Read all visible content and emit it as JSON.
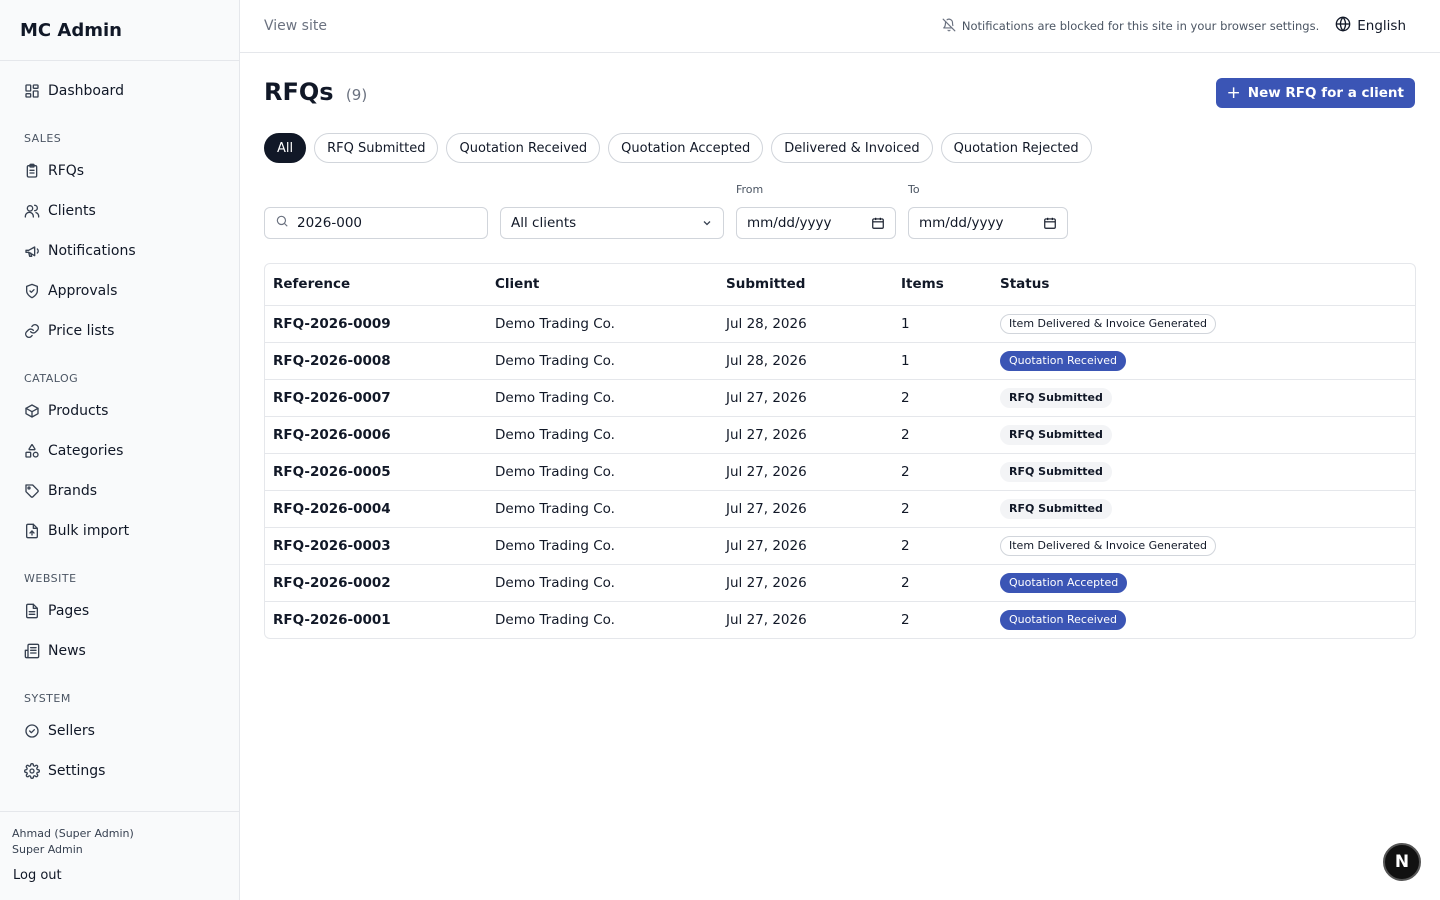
{
  "app": {
    "title": "MC Admin"
  },
  "sidebar": {
    "items": [
      {
        "label": "Dashboard",
        "icon": "dashboard-icon"
      },
      {
        "section": "SALES"
      },
      {
        "label": "RFQs",
        "icon": "clipboard-icon"
      },
      {
        "label": "Clients",
        "icon": "users-icon"
      },
      {
        "label": "Notifications",
        "icon": "megaphone-icon"
      },
      {
        "label": "Approvals",
        "icon": "shield-check-icon"
      },
      {
        "label": "Price lists",
        "icon": "link-icon"
      },
      {
        "section": "CATALOG"
      },
      {
        "label": "Products",
        "icon": "box-icon"
      },
      {
        "label": "Categories",
        "icon": "shapes-icon"
      },
      {
        "label": "Brands",
        "icon": "tag-icon"
      },
      {
        "label": "Bulk import",
        "icon": "file-import-icon"
      },
      {
        "section": "WEBSITE"
      },
      {
        "label": "Pages",
        "icon": "file-text-icon"
      },
      {
        "label": "News",
        "icon": "newspaper-icon"
      },
      {
        "section": "SYSTEM"
      },
      {
        "label": "Sellers",
        "icon": "badge-check-icon"
      },
      {
        "label": "Settings",
        "icon": "gear-icon"
      }
    ],
    "user": {
      "name": "Ahmad (Super Admin)",
      "role": "Super Admin",
      "logout": "Log out"
    }
  },
  "topbar": {
    "view_site": "View site",
    "notice": "Notifications are blocked for this site in your browser settings.",
    "language": "English"
  },
  "page": {
    "title": "RFQs",
    "count": "(9)",
    "new_button": "New RFQ for a client",
    "tabs": [
      "All",
      "RFQ Submitted",
      "Quotation Received",
      "Quotation Accepted",
      "Delivered & Invoiced",
      "Quotation Rejected"
    ],
    "active_tab": "All"
  },
  "filters": {
    "search_value": "2026-000",
    "client_select": "All clients",
    "from_label": "From",
    "to_label": "To",
    "from_value": "mm/dd/yyyy",
    "to_value": "mm/dd/yyyy"
  },
  "table": {
    "columns": [
      "Reference",
      "Client",
      "Submitted",
      "Items",
      "Status"
    ],
    "rows": [
      {
        "reference": "RFQ-2026-0009",
        "client": "Demo Trading Co.",
        "submitted": "Jul 28, 2026",
        "items": "1",
        "status": "Item Delivered & Invoice Generated",
        "variant": "outline"
      },
      {
        "reference": "RFQ-2026-0008",
        "client": "Demo Trading Co.",
        "submitted": "Jul 28, 2026",
        "items": "1",
        "status": "Quotation Received",
        "variant": "primary"
      },
      {
        "reference": "RFQ-2026-0007",
        "client": "Demo Trading Co.",
        "submitted": "Jul 27, 2026",
        "items": "2",
        "status": "RFQ Submitted",
        "variant": "muted"
      },
      {
        "reference": "RFQ-2026-0006",
        "client": "Demo Trading Co.",
        "submitted": "Jul 27, 2026",
        "items": "2",
        "status": "RFQ Submitted",
        "variant": "muted"
      },
      {
        "reference": "RFQ-2026-0005",
        "client": "Demo Trading Co.",
        "submitted": "Jul 27, 2026",
        "items": "2",
        "status": "RFQ Submitted",
        "variant": "muted"
      },
      {
        "reference": "RFQ-2026-0004",
        "client": "Demo Trading Co.",
        "submitted": "Jul 27, 2026",
        "items": "2",
        "status": "RFQ Submitted",
        "variant": "muted"
      },
      {
        "reference": "RFQ-2026-0003",
        "client": "Demo Trading Co.",
        "submitted": "Jul 27, 2026",
        "items": "2",
        "status": "Item Delivered & Invoice Generated",
        "variant": "outline"
      },
      {
        "reference": "RFQ-2026-0002",
        "client": "Demo Trading Co.",
        "submitted": "Jul 27, 2026",
        "items": "2",
        "status": "Quotation Accepted",
        "variant": "primary"
      },
      {
        "reference": "RFQ-2026-0001",
        "client": "Demo Trading Co.",
        "submitted": "Jul 27, 2026",
        "items": "2",
        "status": "Quotation Received",
        "variant": "primary"
      }
    ]
  },
  "fab": {
    "label": "N"
  },
  "colors": {
    "accent": "#3b55b5",
    "dark": "#111827",
    "border": "#e5e7eb"
  }
}
